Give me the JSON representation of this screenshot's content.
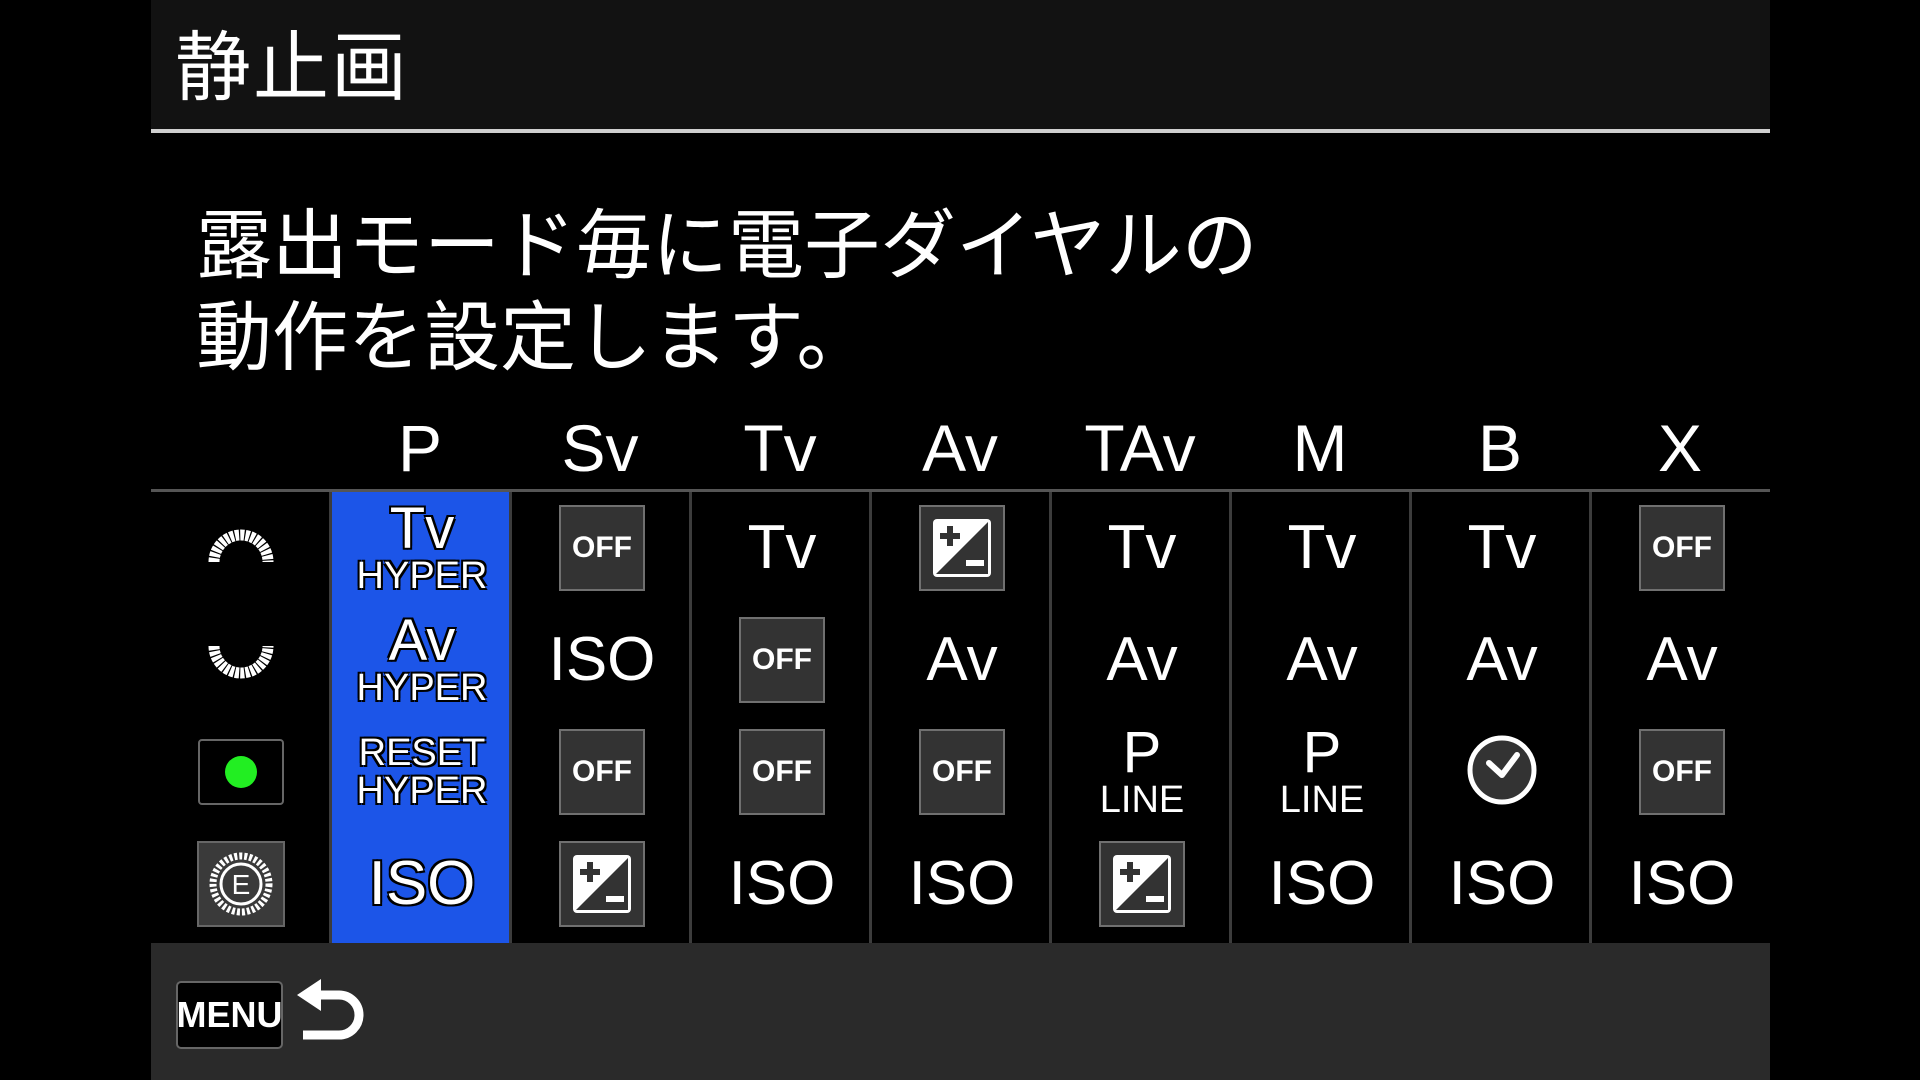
{
  "header": {
    "title": "静止画"
  },
  "description": "露出モード毎に電子ダイヤルの\n動作を設定します。",
  "colors": {
    "selected": "#1c55e8",
    "green_button": "#22ee22"
  },
  "row_icons": [
    {
      "name": "front-dial-icon"
    },
    {
      "name": "rear-dial-icon"
    },
    {
      "name": "green-button-icon"
    },
    {
      "name": "e-dial-icon",
      "label": "E"
    }
  ],
  "modes": [
    {
      "label": "P",
      "selected": true,
      "cells": [
        {
          "type": "text2",
          "main": "Tv",
          "sub": "HYPER"
        },
        {
          "type": "text2",
          "main": "Av",
          "sub": "HYPER"
        },
        {
          "type": "text2small",
          "main": "RESET",
          "sub": "HYPER"
        },
        {
          "type": "text",
          "main": "ISO"
        }
      ]
    },
    {
      "label": "Sv",
      "cells": [
        {
          "type": "off",
          "main": "OFF"
        },
        {
          "type": "text",
          "main": "ISO"
        },
        {
          "type": "off",
          "main": "OFF"
        },
        {
          "type": "ev"
        }
      ]
    },
    {
      "label": "Tv",
      "cells": [
        {
          "type": "text",
          "main": "Tv"
        },
        {
          "type": "off",
          "main": "OFF"
        },
        {
          "type": "off",
          "main": "OFF"
        },
        {
          "type": "text",
          "main": "ISO"
        }
      ]
    },
    {
      "label": "Av",
      "cells": [
        {
          "type": "ev"
        },
        {
          "type": "text",
          "main": "Av"
        },
        {
          "type": "off",
          "main": "OFF"
        },
        {
          "type": "text",
          "main": "ISO"
        }
      ]
    },
    {
      "label": "TAv",
      "cells": [
        {
          "type": "text",
          "main": "Tv"
        },
        {
          "type": "text",
          "main": "Av"
        },
        {
          "type": "text2",
          "main": "P",
          "sub": "LINE"
        },
        {
          "type": "ev"
        }
      ]
    },
    {
      "label": "M",
      "cells": [
        {
          "type": "text",
          "main": "Tv"
        },
        {
          "type": "text",
          "main": "Av"
        },
        {
          "type": "text2",
          "main": "P",
          "sub": "LINE"
        },
        {
          "type": "text",
          "main": "ISO"
        }
      ]
    },
    {
      "label": "B",
      "cells": [
        {
          "type": "text",
          "main": "Tv"
        },
        {
          "type": "text",
          "main": "Av"
        },
        {
          "type": "timer"
        },
        {
          "type": "text",
          "main": "ISO"
        }
      ]
    },
    {
      "label": "X",
      "cells": [
        {
          "type": "off",
          "main": "OFF"
        },
        {
          "type": "text",
          "main": "Av"
        },
        {
          "type": "off",
          "main": "OFF"
        },
        {
          "type": "text",
          "main": "ISO"
        }
      ]
    }
  ],
  "footer": {
    "menu_label": "MENU",
    "back_icon": "back-arrow-icon"
  }
}
